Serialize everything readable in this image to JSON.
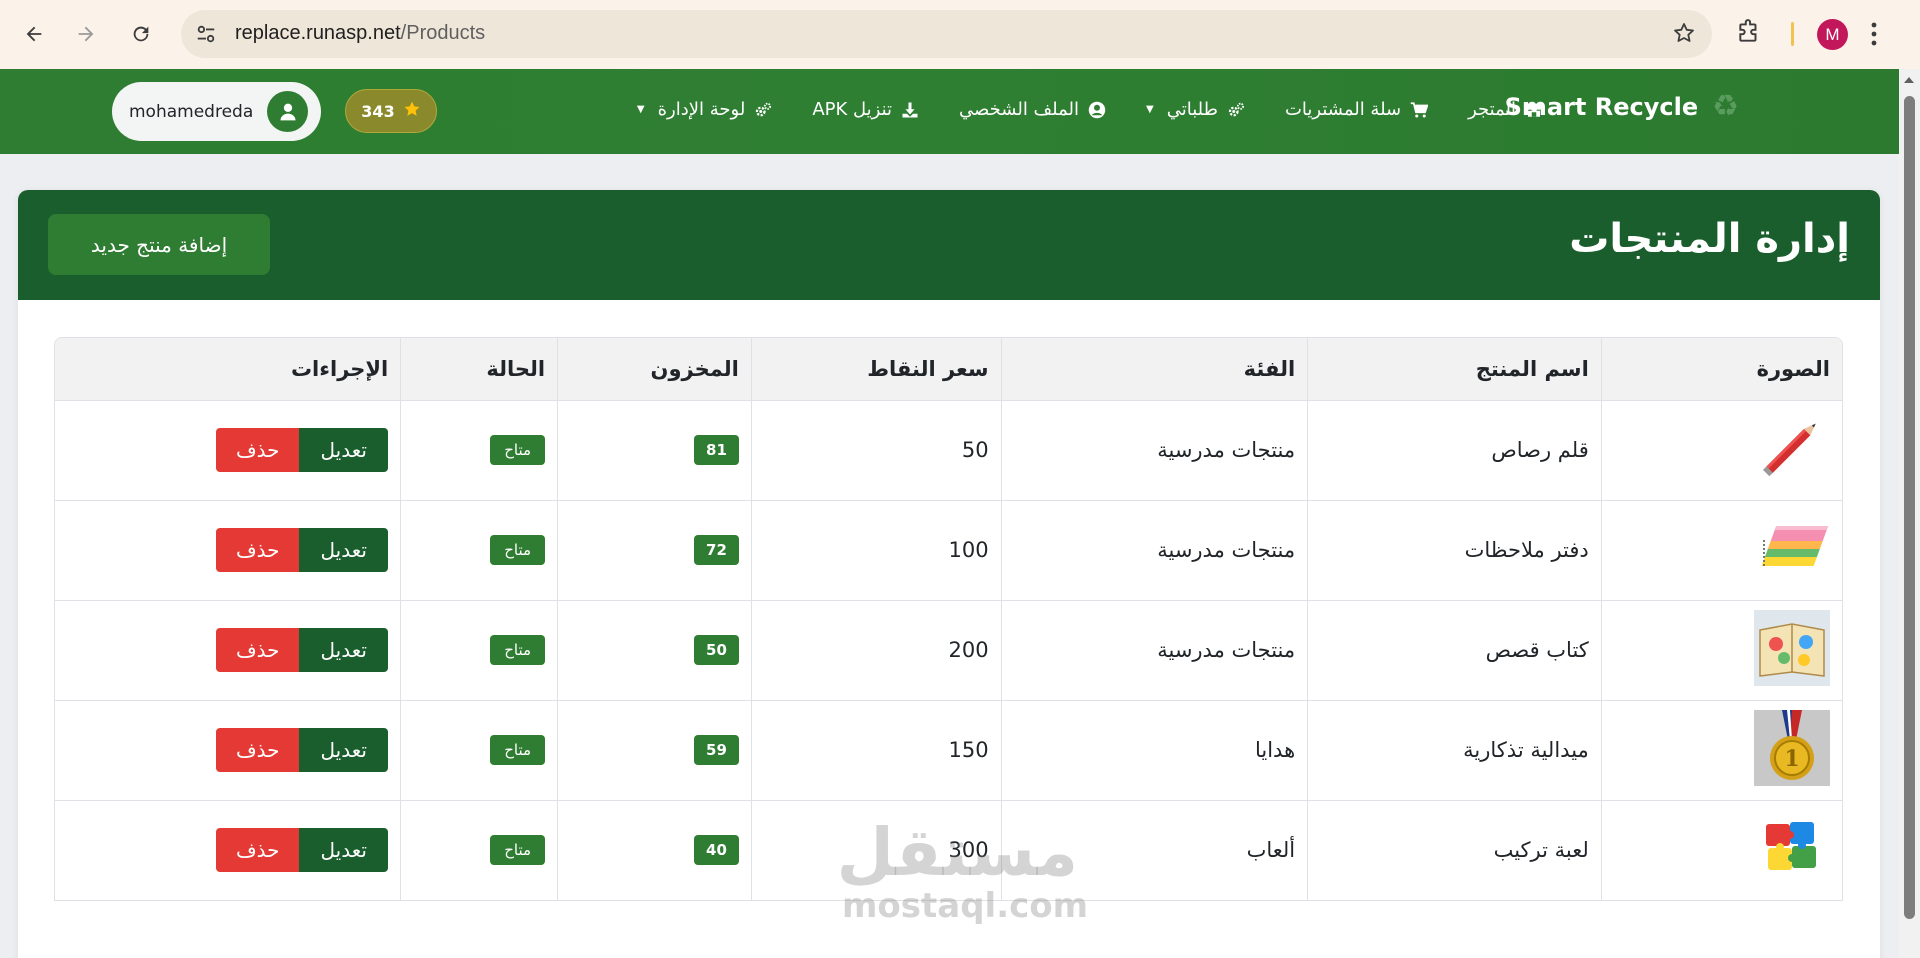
{
  "browser": {
    "url_host": "replace.runasp.net",
    "url_path": "/Products",
    "profile_initial": "M"
  },
  "navbar": {
    "brand": "Smart Recycle",
    "links": [
      {
        "label": "المتجر",
        "icon": "store-icon"
      },
      {
        "label": "سلة المشتريات",
        "icon": "cart-icon"
      },
      {
        "label": "طلباتي",
        "icon": "gears-icon",
        "dropdown": true
      },
      {
        "label": "الملف الشخصي",
        "icon": "user-circle-icon"
      },
      {
        "label": "تنزيل APK",
        "icon": "download-icon"
      },
      {
        "label": "لوحة الإدارة",
        "icon": "gears-icon",
        "dropdown": true
      }
    ],
    "points": "343",
    "username": "mohamedreda"
  },
  "page": {
    "title": "إدارة المنتجات",
    "add_button": "إضافة منتج جديد"
  },
  "table": {
    "headers": [
      "الصورة",
      "اسم المنتج",
      "الفئة",
      "سعر النقاط",
      "المخزون",
      "الحالة",
      "الإجراءات"
    ],
    "edit_label": "تعديل",
    "delete_label": "حذف",
    "rows": [
      {
        "image": "pencil-image",
        "name": "قلم رصاص",
        "category": "منتجات مدرسية",
        "price": "50",
        "stock": "81",
        "status": "متاح"
      },
      {
        "image": "notebooks-image",
        "name": "دفتر ملاحظات",
        "category": "منتجات مدرسية",
        "price": "100",
        "stock": "72",
        "status": "متاح"
      },
      {
        "image": "storybook-image",
        "name": "كتاب قصص",
        "category": "منتجات مدرسية",
        "price": "200",
        "stock": "50",
        "status": "متاح"
      },
      {
        "image": "medal-image",
        "name": "ميدالية تذكارية",
        "category": "هدايا",
        "price": "150",
        "stock": "59",
        "status": "متاح"
      },
      {
        "image": "puzzle-image",
        "name": "لعبة تركيب",
        "category": "ألعاب",
        "price": "300",
        "stock": "40",
        "status": "متاح"
      }
    ]
  },
  "watermark": {
    "arabic": "مستقل",
    "latin": "mostaql.com"
  },
  "colors": {
    "primary": "#2e7d32",
    "dark": "#1b5e2d",
    "danger": "#e53935"
  }
}
